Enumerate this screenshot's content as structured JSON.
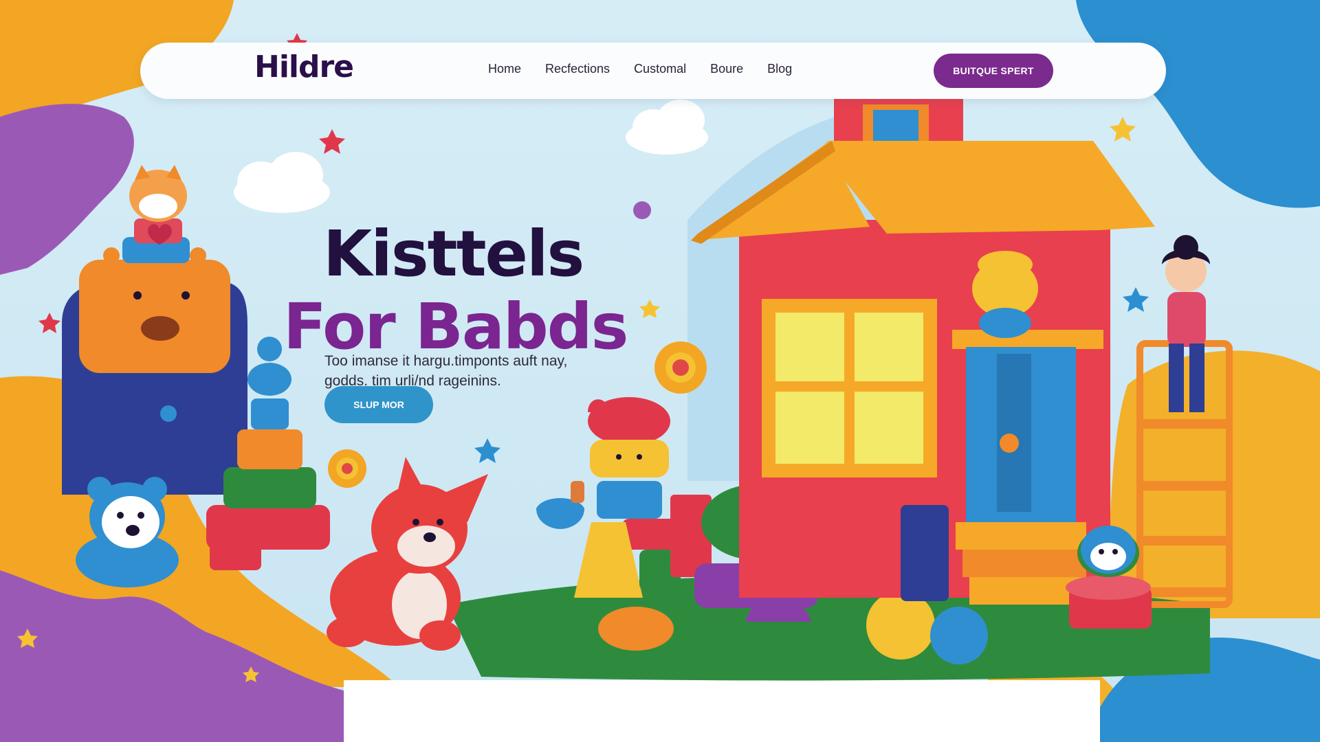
{
  "brand": {
    "logo": "Hildre"
  },
  "nav": {
    "links": [
      "Home",
      "Recfections",
      "Customal",
      "Boure",
      "Blog"
    ],
    "cta": "BUITQUE SPERT"
  },
  "hero": {
    "title_line1": "Kisttels",
    "title_line2": "For Babds",
    "description": "Too imanse it hargu.timponts auft nay, godds. tim urli/nd rageinins.",
    "button": "SLUP MOR"
  },
  "colors": {
    "brand_purple": "#7b2a8d",
    "title_dark": "#22103f",
    "button_blue": "#2f94c9",
    "orange_blob": "#f3a623",
    "purple_blob": "#9b59b6",
    "blue_blob": "#2b8fd0"
  },
  "icons": [
    "star-icon",
    "cloud-icon",
    "flower-icon"
  ]
}
